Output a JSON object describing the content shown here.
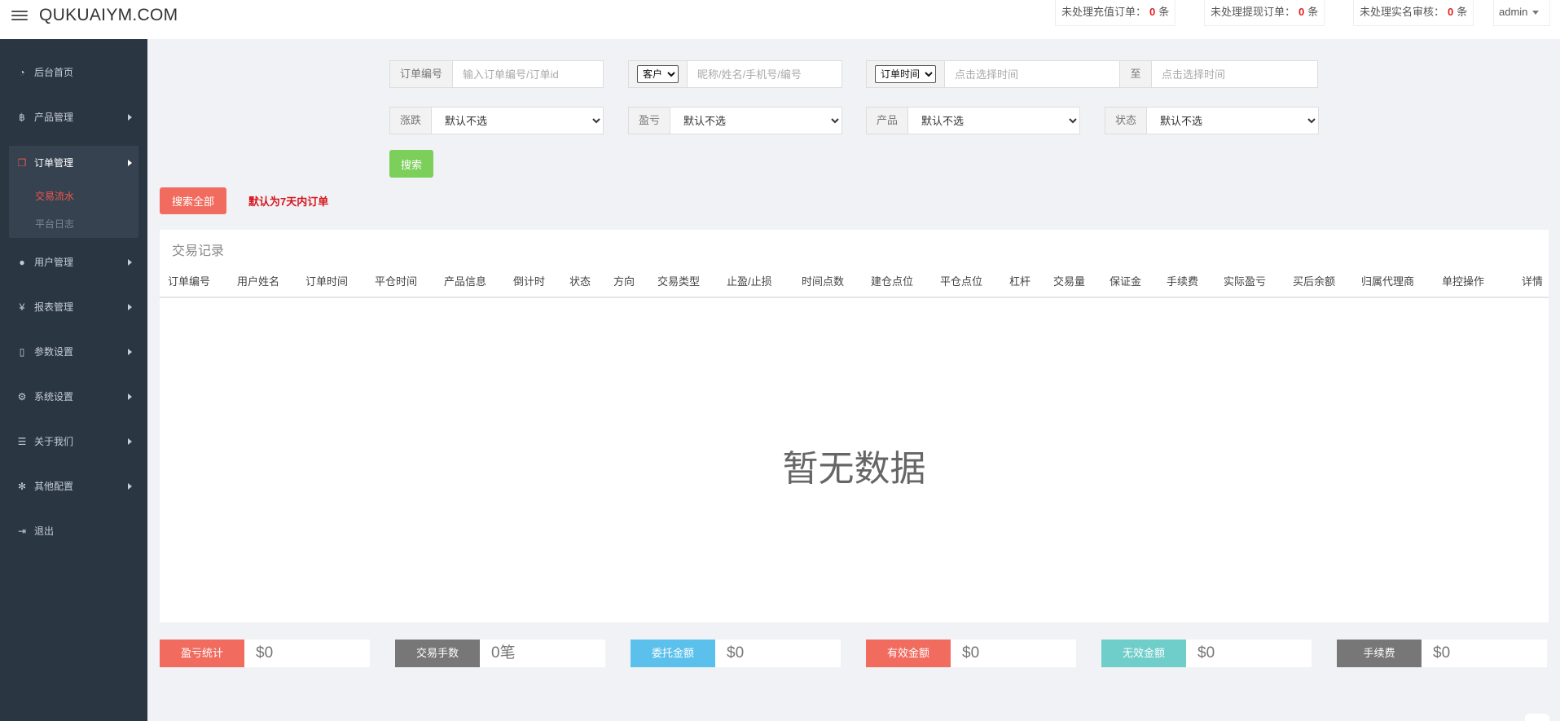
{
  "header": {
    "brand": "QUKUAIYM.COM",
    "notices": [
      {
        "label": "未处理充值订单：",
        "count": "0",
        "unit": "条"
      },
      {
        "label": "未处理提现订单：",
        "count": "0",
        "unit": "条"
      },
      {
        "label": "未处理实名审核：",
        "count": "0",
        "unit": "条"
      }
    ],
    "user": "admin"
  },
  "sidebar": {
    "items": [
      {
        "label": "后台首页",
        "icon": "dashboard-icon"
      },
      {
        "label": "产品管理",
        "icon": "bitcoin-icon"
      },
      {
        "label": "订单管理",
        "icon": "copy-icon"
      },
      {
        "label": "用户管理",
        "icon": "user-icon"
      },
      {
        "label": "报表管理",
        "icon": "yen-icon"
      },
      {
        "label": "参数设置",
        "icon": "file-icon"
      },
      {
        "label": "系统设置",
        "icon": "gears-icon"
      },
      {
        "label": "关于我们",
        "icon": "list-icon"
      },
      {
        "label": "其他配置",
        "icon": "gear-icon"
      },
      {
        "label": "退出",
        "icon": "sign-out-icon"
      }
    ],
    "subitems": [
      "交易流水",
      "平台日志"
    ]
  },
  "search": {
    "order_no_label": "订单编号",
    "order_no_placeholder": "输入订单编号/订单id",
    "customer_select": "客户",
    "customer_placeholder": "昵称/姓名/手机号/编号",
    "time_select": "订单时间",
    "time_start_placeholder": "点击选择时间",
    "to_label": "至",
    "time_end_placeholder": "点击选择时间",
    "filters": [
      {
        "label": "涨跌",
        "value": "默认不选"
      },
      {
        "label": "盈亏",
        "value": "默认不选"
      },
      {
        "label": "产品",
        "value": "默认不选"
      },
      {
        "label": "状态",
        "value": "默认不选"
      }
    ],
    "search_button": "搜索",
    "search_all_button": "搜索全部",
    "default_note": "默认为7天内订单"
  },
  "table": {
    "title": "交易记录",
    "columns": [
      "订单编号",
      "用户姓名",
      "订单时间",
      "平仓时间",
      "产品信息",
      "倒计时",
      "状态",
      "方向",
      "交易类型",
      "止盈/止损",
      "时间点数",
      "建仓点位",
      "平仓点位",
      "杠杆",
      "交易量",
      "保证金",
      "手续费",
      "实际盈亏",
      "买后余额",
      "归属代理商",
      "单控操作",
      "详情"
    ],
    "empty_text": "暂无数据"
  },
  "stats": [
    {
      "label": "盈亏统计",
      "value": "$0",
      "color": "#f16c5f"
    },
    {
      "label": "交易手数",
      "value": "0笔",
      "color": "#777777"
    },
    {
      "label": "委托金额",
      "value": "$0",
      "color": "#5bc0ec"
    },
    {
      "label": "有效金额",
      "value": "$0",
      "color": "#f16c5f"
    },
    {
      "label": "无效金额",
      "value": "$0",
      "color": "#6fcdca"
    },
    {
      "label": "手续费",
      "value": "$0",
      "color": "#777777"
    }
  ]
}
